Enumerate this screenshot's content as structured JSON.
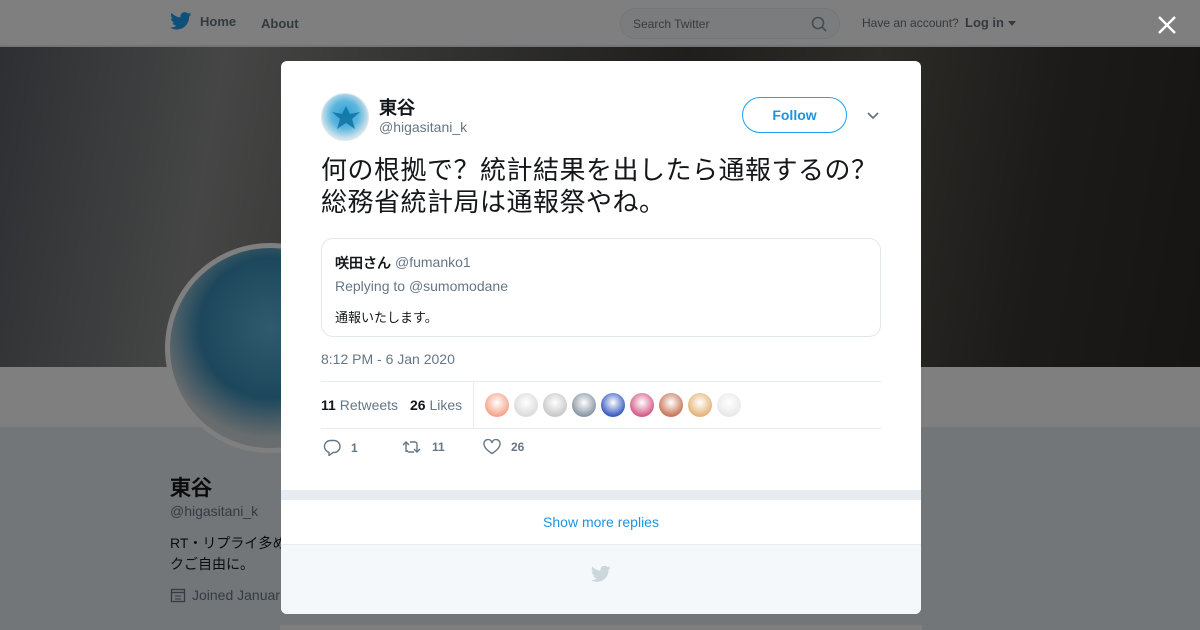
{
  "topbar": {
    "home_label": "Home",
    "about_label": "About",
    "search_placeholder": "Search Twitter",
    "have_account": "Have an account?",
    "login_label": "Log in"
  },
  "profile": {
    "name": "東谷",
    "handle": "@higasitani_k",
    "bio": "RT・リプライ多め\nクご自由に。",
    "joined": "Joined Januar"
  },
  "tweet": {
    "author_name": "東谷",
    "author_handle": "@higasitani_k",
    "follow_label": "Follow",
    "text": "何の根拠で？統計結果を出したら通報するの？総務省統計局は通報祭やね。",
    "quoted": {
      "name": "咲田さん",
      "handle": "@fumanko1",
      "replying_prefix": "Replying to",
      "replying_to": "@sumomodane",
      "text": "通報いたします。"
    },
    "timestamp": "8:12 PM - 6 Jan 2020",
    "retweet_count": "11",
    "retweet_label": "Retweets",
    "like_count": "26",
    "like_label": "Likes",
    "actions": {
      "reply_count": "1",
      "retweet_count": "11",
      "like_count": "26"
    },
    "show_more_replies": "Show more replies"
  },
  "colors": {
    "accent": "#1da1f2",
    "link": "#1b95e0",
    "secondary_text": "#657786"
  },
  "likers": [
    {
      "color": "#f4a58a"
    },
    {
      "color": "#dcdcdc"
    },
    {
      "color": "#c9c9c9"
    },
    {
      "color": "#8b98a5"
    },
    {
      "color": "#3b5fc0"
    },
    {
      "color": "#d45e8a"
    },
    {
      "color": "#c8795a"
    },
    {
      "color": "#e5b47a"
    },
    {
      "color": "#e9e9e9"
    }
  ]
}
